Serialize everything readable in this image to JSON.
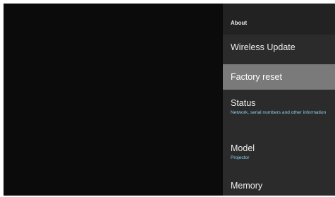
{
  "panel": {
    "title": "About",
    "items": [
      {
        "label": "Wireless Update",
        "sub": ""
      },
      {
        "label": "Factory reset",
        "sub": ""
      },
      {
        "label": "Status",
        "sub": "Network, serial numbers and other information"
      },
      {
        "label": "Model",
        "sub": "Projector"
      },
      {
        "label": "Memory",
        "sub": ""
      }
    ]
  },
  "colors": {
    "background": "#0b0b0b",
    "panel": "#2b2b2b",
    "selected": "#7a7a7a",
    "subtitle": "#8fd1e6"
  }
}
